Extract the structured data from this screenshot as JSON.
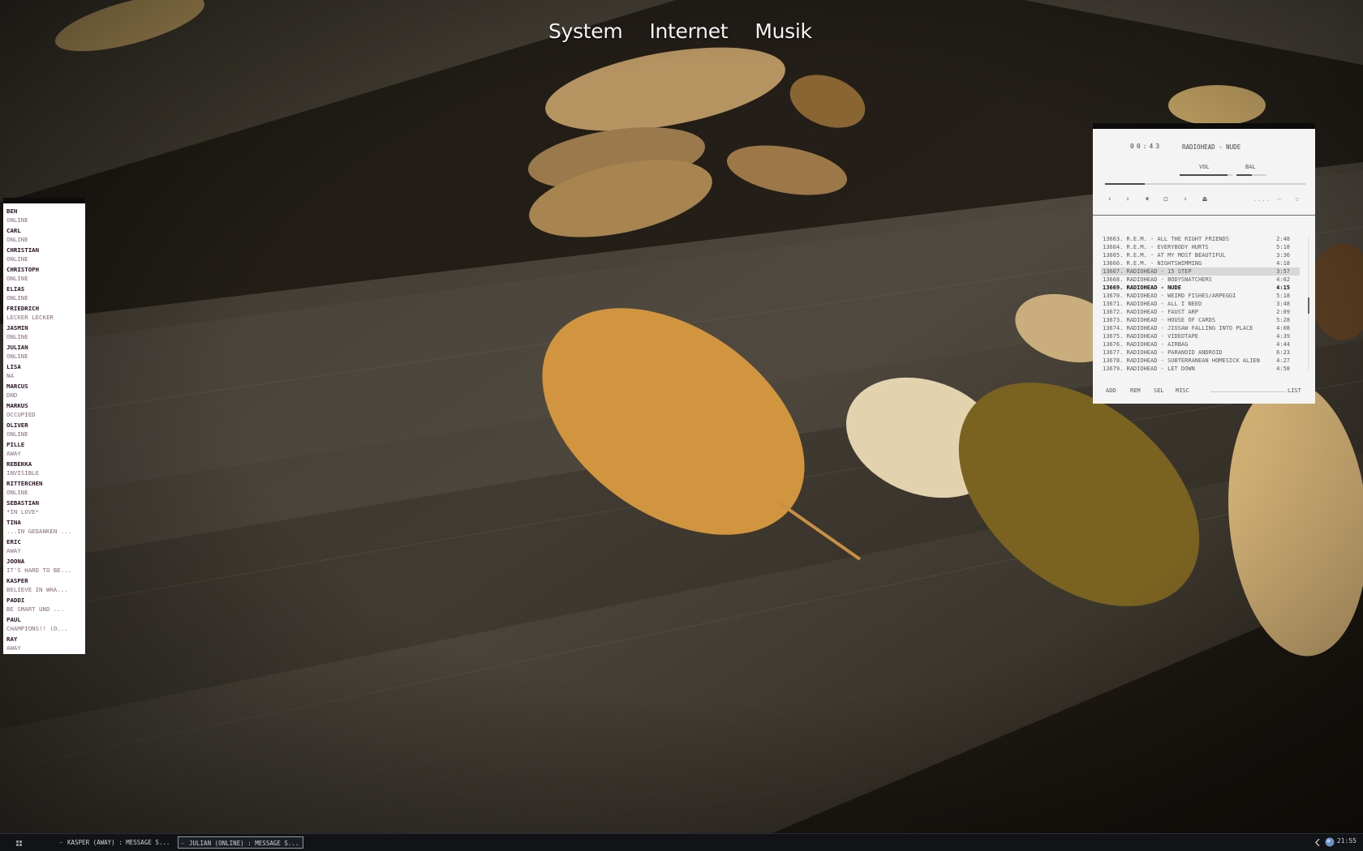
{
  "top_menu": [
    "System",
    "Internet",
    "Musik"
  ],
  "buddies": [
    {
      "name": "Ben",
      "status": "Online"
    },
    {
      "name": "Carl",
      "status": "Online"
    },
    {
      "name": "Christian",
      "status": "Online"
    },
    {
      "name": "Christoph",
      "status": "Online"
    },
    {
      "name": "Elias",
      "status": "Online"
    },
    {
      "name": "Friedrich",
      "status": "Lecker Lecker"
    },
    {
      "name": "Jasmin",
      "status": "Online"
    },
    {
      "name": "Julian",
      "status": "Online"
    },
    {
      "name": "Lisa",
      "status": "NA"
    },
    {
      "name": "Marcus",
      "status": "DND"
    },
    {
      "name": "Markus",
      "status": "Occupied"
    },
    {
      "name": "Oliver",
      "status": "Online"
    },
    {
      "name": "Pille",
      "status": "Away"
    },
    {
      "name": "Rebekka",
      "status": "Invisible"
    },
    {
      "name": "Ritterchen",
      "status": "Online"
    },
    {
      "name": "Sebastian",
      "status": "*in Love*"
    },
    {
      "name": "Tina",
      "status": "...in Gedanken ..."
    },
    {
      "name": "Eric",
      "status": "Away"
    },
    {
      "name": "Joona",
      "status": "It's hard to be..."
    },
    {
      "name": "Kasper",
      "status": "Believe in wha..."
    },
    {
      "name": "Paddi",
      "status": "be smart und ..."
    },
    {
      "name": "Paul",
      "status": "Champions!! (o..."
    },
    {
      "name": "Ray",
      "status": "Away"
    }
  ],
  "player": {
    "time": "00:43",
    "now_playing": "Radiohead - Nude",
    "vol_label": "VOL",
    "bal_label": "BAL",
    "volume": 0.9,
    "balance": 0.5,
    "seek": 0.2,
    "controls": {
      "prev": "‹",
      "play": "›",
      "pause": "⏸",
      "stop": "◻",
      "next": "›",
      "eject": "⏏",
      "dots": "....",
      "dash": "—",
      "square": "▫"
    },
    "playlist": [
      {
        "title": "13663. R.E.M. - All the Right Friends",
        "duration": "2:48"
      },
      {
        "title": "13664. R.E.M. - Everybody Hurts",
        "duration": "5:18"
      },
      {
        "title": "13665. R.E.M. - At My Most Beautiful",
        "duration": "3:36"
      },
      {
        "title": "13666. R.E.M. - Nightswimming",
        "duration": "4:18"
      },
      {
        "title": "13667. Radiohead - 15 Step",
        "duration": "3:57"
      },
      {
        "title": "13668. Radiohead - Bodysnatchers",
        "duration": "4:02"
      },
      {
        "title": "13669. Radiohead - Nude",
        "duration": "4:15"
      },
      {
        "title": "13670. Radiohead - Weird Fishes/Arpeggi",
        "duration": "5:18"
      },
      {
        "title": "13671. Radiohead - All I Need",
        "duration": "3:48"
      },
      {
        "title": "13672. Radiohead - Faust Arp",
        "duration": "2:09"
      },
      {
        "title": "13673. Radiohead - House of Cards",
        "duration": "5:28"
      },
      {
        "title": "13674. Radiohead - Jigsaw Falling Into Place",
        "duration": "4:08"
      },
      {
        "title": "13675. Radiohead - Videotape",
        "duration": "4:39"
      },
      {
        "title": "13676. Radiohead - Airbag",
        "duration": "4:44"
      },
      {
        "title": "13677. Radiohead - Paranoid Android",
        "duration": "6:23"
      },
      {
        "title": "13678. Radiohead - Subterranean Homesick Alien",
        "duration": "4:27"
      },
      {
        "title": "13679. Radiohead - Let Down",
        "duration": "4:58"
      }
    ],
    "selected_index": 4,
    "current_index": 6,
    "buttons": [
      "ADD",
      "REM",
      "SEL",
      "MISC",
      "LIST"
    ]
  },
  "taskbar": {
    "tasks": [
      {
        "label": "Kasper (Away) : Message S..."
      },
      {
        "label": "Julian (Online) : Message S..."
      }
    ],
    "active_index": 1,
    "clock": "21:55"
  },
  "colors": {
    "panel_bg": "#f4f4f4",
    "buddy_name": "#2b0f24",
    "buddy_status": "#8a6a7d",
    "taskbar_bg": "#111316"
  }
}
